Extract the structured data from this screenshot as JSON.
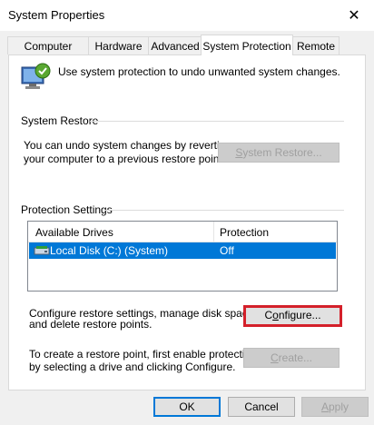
{
  "window": {
    "title": "System Properties",
    "close_glyph": "✕"
  },
  "tabs": [
    {
      "label": "Computer Name",
      "active": false
    },
    {
      "label": "Hardware",
      "active": false
    },
    {
      "label": "Advanced",
      "active": false
    },
    {
      "label": "System Protection",
      "active": true
    },
    {
      "label": "Remote",
      "active": false
    }
  ],
  "intro": {
    "icon": "system-protection-shield-icon",
    "text": "Use system protection to undo unwanted system changes."
  },
  "system_restore": {
    "heading": "System Restore",
    "description_line1": "You can undo system changes by reverting",
    "description_line2": "your computer to a previous restore point.",
    "button_prefix": "",
    "button_mnemonic": "S",
    "button_rest": "ystem Restore...",
    "button_enabled": false
  },
  "protection_settings": {
    "heading": "Protection Settings",
    "columns": [
      "Available Drives",
      "Protection"
    ],
    "rows": [
      {
        "drive": "Local Disk (C:) (System)",
        "protection": "Off",
        "icon": "hard-drive-icon",
        "selected": true
      }
    ],
    "configure_text_line1": "Configure restore settings, manage disk space,",
    "configure_text_line2": "and delete restore points.",
    "configure_button_prefix": "C",
    "configure_button_mnemonic": "o",
    "configure_button_rest": "nfigure...",
    "create_text_line1": "To create a restore point, first enable protection",
    "create_text_line2": "by selecting a drive and clicking Configure.",
    "create_button_prefix": "",
    "create_button_mnemonic": "C",
    "create_button_rest": "reate...",
    "create_button_enabled": false
  },
  "footer": {
    "ok_label": "OK",
    "cancel_label": "Cancel",
    "apply_prefix": "",
    "apply_mnemonic": "A",
    "apply_rest": "pply",
    "apply_enabled": false
  },
  "colors": {
    "selection": "#0078d7",
    "highlight_border": "#d4202a"
  }
}
